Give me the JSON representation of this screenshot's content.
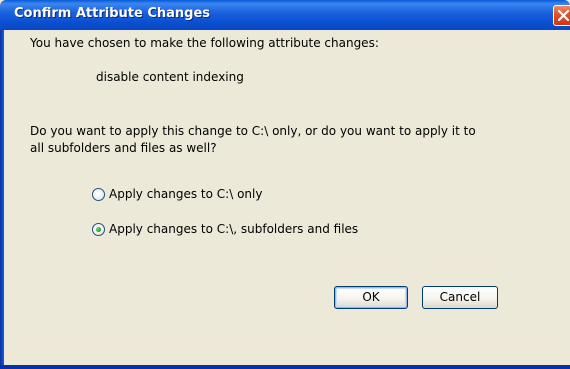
{
  "window": {
    "title": "Confirm Attribute Changes"
  },
  "message": {
    "intro": "You have chosen to make the following attribute changes:",
    "change": "disable content indexing",
    "question_line1": "Do you want to apply this change to C:\\ only, or do you want to apply it to",
    "question_line2": "all subfolders and files as well?"
  },
  "options": [
    {
      "label": "Apply changes to C:\\ only",
      "checked": false
    },
    {
      "label": "Apply changes to C:\\, subfolders and files",
      "checked": true
    }
  ],
  "buttons": {
    "ok": "OK",
    "cancel": "Cancel"
  }
}
